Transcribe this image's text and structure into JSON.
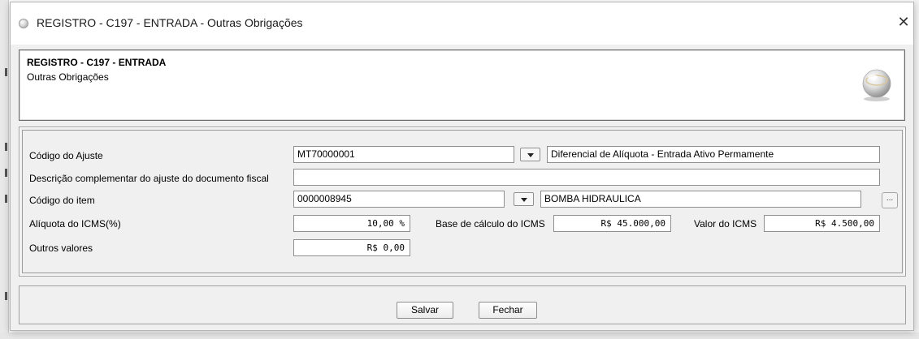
{
  "window": {
    "title": "REGISTRO - C197 - ENTRADA - Outras Obrigações",
    "close_glyph": "✕",
    "icon": "app-globe-icon"
  },
  "header": {
    "title": "REGISTRO - C197 - ENTRADA",
    "subtitle": "Outras Obrigações",
    "logo_icon": "globe-logo-icon"
  },
  "form": {
    "codigo_ajuste": {
      "label": "Código do Ajuste",
      "value": "MT70000001",
      "description": "Diferencial de Alíquota - Entrada Ativo Permamente"
    },
    "descricao_complementar": {
      "label": "Descrição complementar do ajuste do documento fiscal",
      "value": ""
    },
    "codigo_item": {
      "label": "Código do item",
      "value": "0000008945",
      "description": "BOMBA HIDRAULICA",
      "ellipsis": "..."
    },
    "aliquota_icms": {
      "label": "Alíquota do ICMS(%)",
      "value": "10,00 %"
    },
    "base_calculo_icms": {
      "label": "Base de cálculo do ICMS",
      "value": "R$ 45.000,00"
    },
    "valor_icms": {
      "label": "Valor do ICMS",
      "value": "R$ 4.500,00"
    },
    "outros_valores": {
      "label": "Outros valores",
      "value": "R$ 0,00"
    }
  },
  "footer": {
    "save_label": "Salvar",
    "close_label": "Fechar"
  },
  "colors": {
    "dialog_bg": "#f0f0f0",
    "field_border": "#8f8f8f",
    "header_border": "#6e6e6e"
  }
}
